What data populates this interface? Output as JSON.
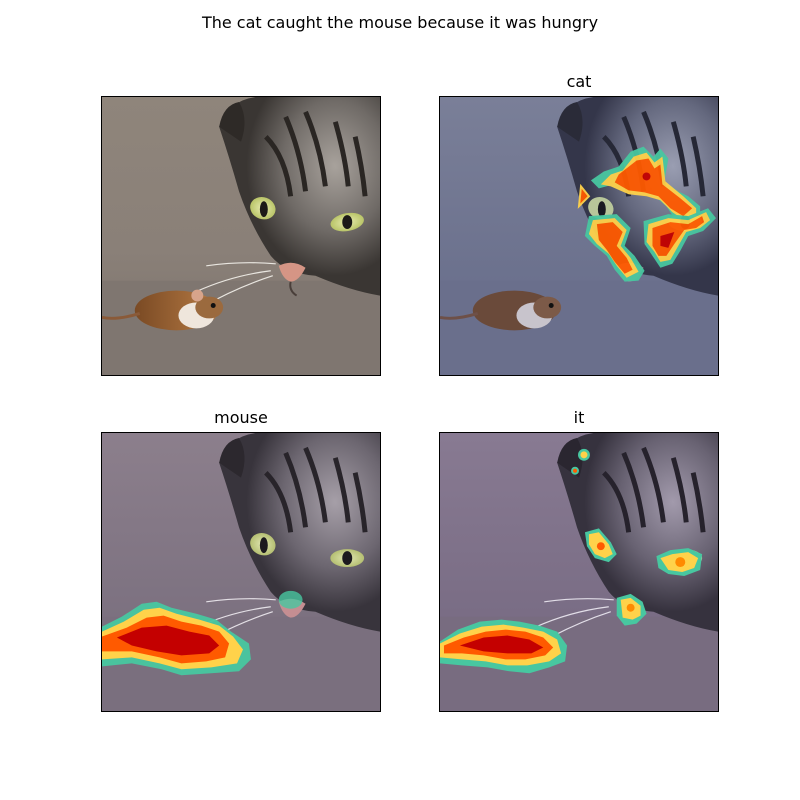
{
  "figure": {
    "title": "The cat caught the mouse because it was hungry"
  },
  "panels": [
    {
      "title": "",
      "overlay": "none",
      "tint": "none"
    },
    {
      "title": "cat",
      "overlay": "cat-face-attention-heatmap",
      "tint": "#5d6d9c"
    },
    {
      "title": "mouse",
      "overlay": "mouse-attention-heatmap",
      "tint": "#7d6b8a"
    },
    {
      "title": "it",
      "overlay": "mouse-and-cat-attention-heatmap",
      "tint": "#7d6b8a"
    }
  ],
  "colors": {
    "heat_high": "#c40000",
    "heat_mid": "#ff5a00",
    "heat_low": "#ffd24a",
    "heat_edge": "#48c7a0"
  }
}
